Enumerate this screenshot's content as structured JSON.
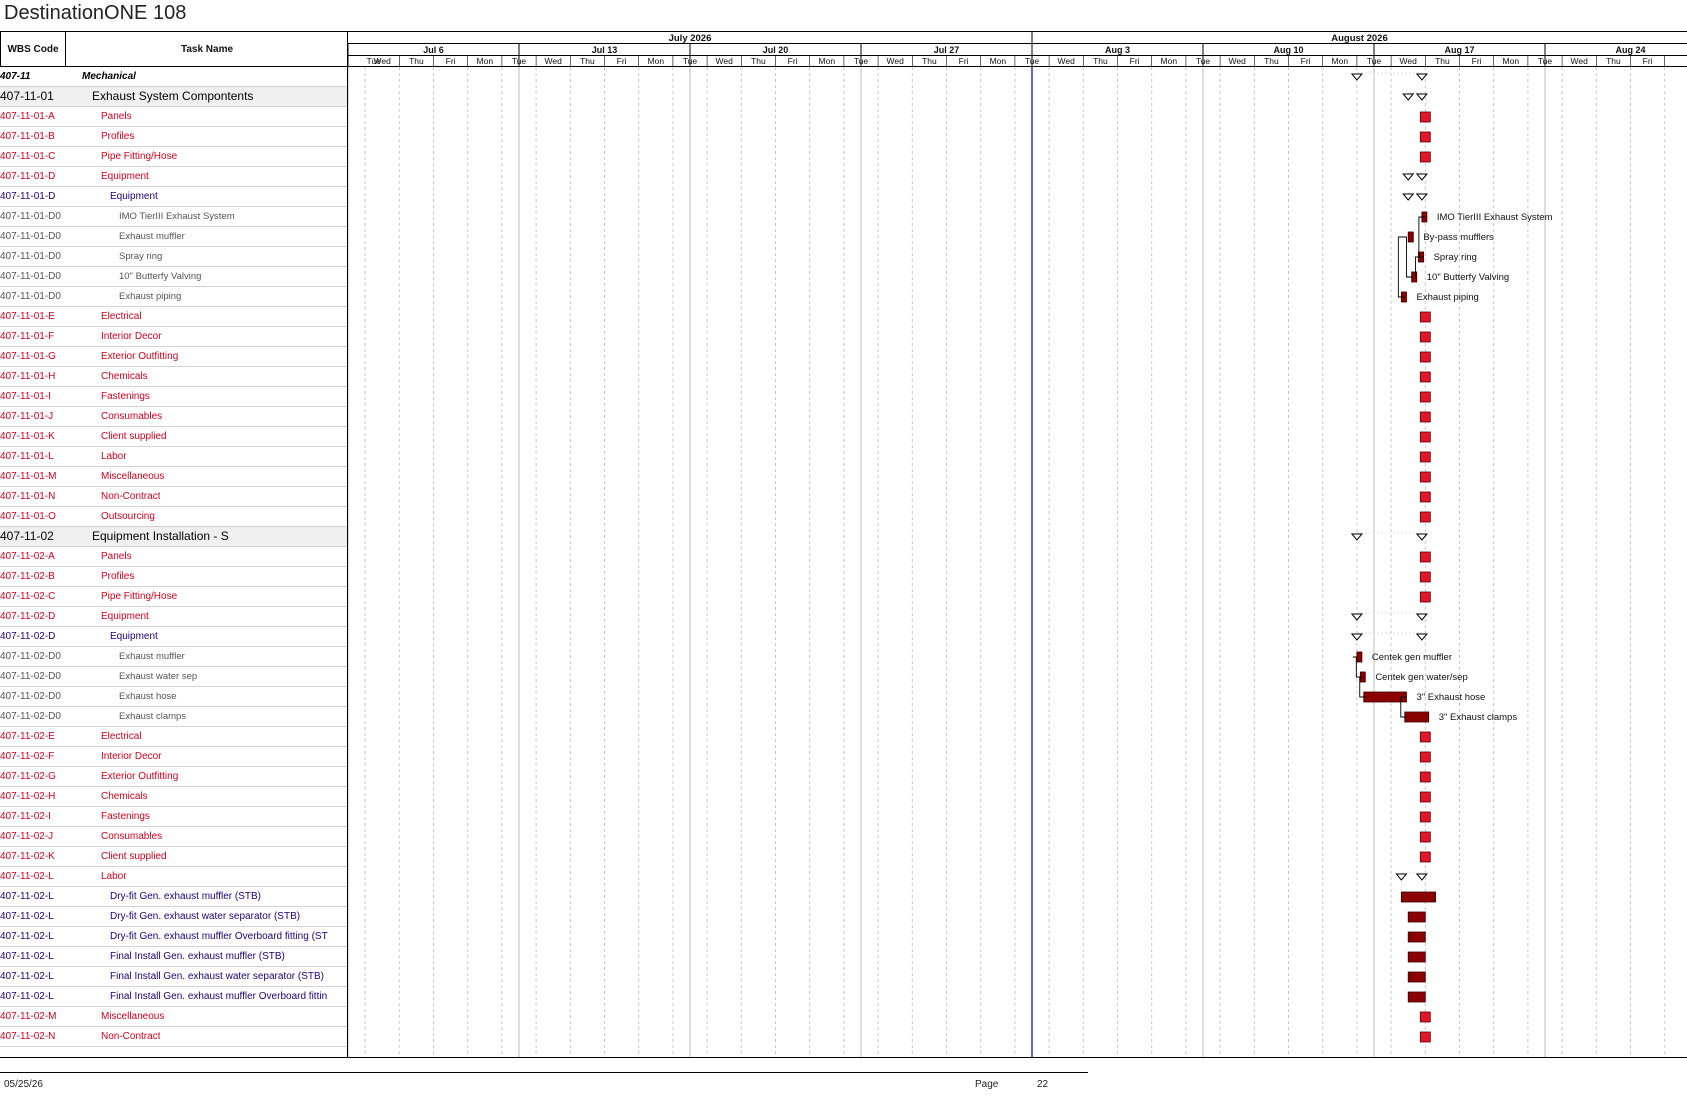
{
  "title": "DestinationONE 108",
  "columns": {
    "wbs": "WBS Code",
    "task": "Task Name"
  },
  "timescale": {
    "months": [
      {
        "label": "July 2026"
      },
      {
        "label": "August 2026"
      }
    ],
    "weeks": [
      "Jul 6",
      "Jul 13",
      "Jul 20",
      "Jul 27",
      "Aug 3",
      "Aug 10",
      "Aug 17",
      "Aug 24"
    ],
    "days": [
      "Tue",
      "Wed",
      "Thu",
      "Fri",
      "Mon",
      "Tue",
      "Wed",
      "Thu",
      "Fri",
      "Mon",
      "Tue",
      "Wed",
      "Thu",
      "Fri",
      "Mon",
      "Tue",
      "Wed",
      "Thu",
      "Fri",
      "Mon",
      "Tue",
      "Wed",
      "Thu",
      "Fri",
      "Mon",
      "Tue",
      "Wed",
      "Thu",
      "Fri",
      "Mon",
      "Tue",
      "Wed",
      "Thu",
      "Fri",
      "Mon",
      "Tue",
      "Wed",
      "Thu",
      "Fri"
    ]
  },
  "rows": [
    {
      "wbs": "407-11",
      "task": "Mechanical",
      "level": 0,
      "marker": "summary",
      "start": 29.0,
      "end": 30.9
    },
    {
      "wbs": "407-11-01",
      "task": "Exhaust System Compontents",
      "level": 1,
      "marker": "summary",
      "start": 30.5,
      "end": 30.9
    },
    {
      "wbs": "407-11-01-A",
      "task": "Panels",
      "level": 2,
      "marker": "milestone",
      "start": 31.0
    },
    {
      "wbs": "407-11-01-B",
      "task": "Profiles",
      "level": 2,
      "marker": "milestone",
      "start": 31.0
    },
    {
      "wbs": "407-11-01-C",
      "task": "Pipe Fitting/Hose",
      "level": 2,
      "marker": "milestone",
      "start": 31.0
    },
    {
      "wbs": "407-11-01-D",
      "task": "Equipment",
      "level": 2,
      "marker": "summary",
      "start": 30.5,
      "end": 30.9
    },
    {
      "wbs": "407-11-01-D",
      "task": "Equipment",
      "level": 3,
      "marker": "summary",
      "start": 30.5,
      "end": 30.9
    },
    {
      "wbs": "407-11-01-D0",
      "task": "IMO TierIII Exhaust System",
      "level": 4,
      "marker": "task",
      "start": 30.9,
      "end": 31.0,
      "bar_label": "IMO TierIII Exhaust System"
    },
    {
      "wbs": "407-11-01-D0",
      "task": "Exhaust muffler",
      "level": 4,
      "marker": "task",
      "start": 30.5,
      "end": 30.65,
      "bar_label": "By-pass mufflers"
    },
    {
      "wbs": "407-11-01-D0",
      "task": "Spray ring",
      "level": 4,
      "marker": "task",
      "start": 30.8,
      "end": 30.95,
      "bar_label": "Spray ring"
    },
    {
      "wbs": "407-11-01-D0",
      "task": "10\" Butterfy Valving",
      "level": 4,
      "marker": "task",
      "start": 30.6,
      "end": 30.75,
      "bar_label": "10\" Butterfy Valving"
    },
    {
      "wbs": "407-11-01-D0",
      "task": "Exhaust piping",
      "level": 4,
      "marker": "task",
      "start": 30.3,
      "end": 30.45,
      "bar_label": "Exhaust piping"
    },
    {
      "wbs": "407-11-01-E",
      "task": "Electrical",
      "level": 2,
      "marker": "milestone",
      "start": 31.0
    },
    {
      "wbs": "407-11-01-F",
      "task": "Interior Decor",
      "level": 2,
      "marker": "milestone",
      "start": 31.0
    },
    {
      "wbs": "407-11-01-G",
      "task": "Exterior Outfitting",
      "level": 2,
      "marker": "milestone",
      "start": 31.0
    },
    {
      "wbs": "407-11-01-H",
      "task": "Chemicals",
      "level": 2,
      "marker": "milestone",
      "start": 31.0
    },
    {
      "wbs": "407-11-01-I",
      "task": "Fastenings",
      "level": 2,
      "marker": "milestone",
      "start": 31.0
    },
    {
      "wbs": "407-11-01-J",
      "task": "Consumables",
      "level": 2,
      "marker": "milestone",
      "start": 31.0
    },
    {
      "wbs": "407-11-01-K",
      "task": "Client supplied",
      "level": 2,
      "marker": "milestone",
      "start": 31.0
    },
    {
      "wbs": "407-11-01-L",
      "task": "Labor",
      "level": 2,
      "marker": "milestone",
      "start": 31.0
    },
    {
      "wbs": "407-11-01-M",
      "task": "Miscellaneous",
      "level": 2,
      "marker": "milestone",
      "start": 31.0
    },
    {
      "wbs": "407-11-01-N",
      "task": "Non-Contract",
      "level": 2,
      "marker": "milestone",
      "start": 31.0
    },
    {
      "wbs": "407-11-01-O",
      "task": "Outsourcing",
      "level": 2,
      "marker": "milestone",
      "start": 31.0
    },
    {
      "wbs": "407-11-02",
      "task": "Equipment Installation - S",
      "level": 1,
      "marker": "summary",
      "start": 29.0,
      "end": 30.9
    },
    {
      "wbs": "407-11-02-A",
      "task": "Panels",
      "level": 2,
      "marker": "milestone",
      "start": 31.0
    },
    {
      "wbs": "407-11-02-B",
      "task": "Profiles",
      "level": 2,
      "marker": "milestone",
      "start": 31.0
    },
    {
      "wbs": "407-11-02-C",
      "task": "Pipe Fitting/Hose",
      "level": 2,
      "marker": "milestone",
      "start": 31.0
    },
    {
      "wbs": "407-11-02-D",
      "task": "Equipment",
      "level": 2,
      "marker": "summary",
      "start": 29.0,
      "end": 30.9
    },
    {
      "wbs": "407-11-02-D",
      "task": "Equipment",
      "level": 3,
      "marker": "summary",
      "start": 29.0,
      "end": 30.9
    },
    {
      "wbs": "407-11-02-D0",
      "task": "Exhaust muffler",
      "level": 4,
      "marker": "task",
      "start": 29.0,
      "end": 29.1,
      "bar_label": "Centek gen muffler"
    },
    {
      "wbs": "407-11-02-D0",
      "task": "Exhaust water sep",
      "level": 4,
      "marker": "task",
      "start": 29.1,
      "end": 29.2,
      "bar_label": "Centek gen water/sep"
    },
    {
      "wbs": "407-11-02-D0",
      "task": "Exhaust hose",
      "level": 4,
      "marker": "task",
      "start": 29.2,
      "end": 30.45,
      "bar_label": "3\" Exhaust hose"
    },
    {
      "wbs": "407-11-02-D0",
      "task": "Exhaust clamps",
      "level": 4,
      "marker": "task",
      "start": 30.4,
      "end": 31.1,
      "bar_label": "3\" Exhaust clamps"
    },
    {
      "wbs": "407-11-02-E",
      "task": "Electrical",
      "level": 2,
      "marker": "milestone",
      "start": 31.0
    },
    {
      "wbs": "407-11-02-F",
      "task": "Interior Decor",
      "level": 2,
      "marker": "milestone",
      "start": 31.0
    },
    {
      "wbs": "407-11-02-G",
      "task": "Exterior Outfitting",
      "level": 2,
      "marker": "milestone",
      "start": 31.0
    },
    {
      "wbs": "407-11-02-H",
      "task": "Chemicals",
      "level": 2,
      "marker": "milestone",
      "start": 31.0
    },
    {
      "wbs": "407-11-02-I",
      "task": "Fastenings",
      "level": 2,
      "marker": "milestone",
      "start": 31.0
    },
    {
      "wbs": "407-11-02-J",
      "task": "Consumables",
      "level": 2,
      "marker": "milestone",
      "start": 31.0
    },
    {
      "wbs": "407-11-02-K",
      "task": "Client supplied",
      "level": 2,
      "marker": "milestone",
      "start": 31.0
    },
    {
      "wbs": "407-11-02-L",
      "task": "Labor",
      "level": 2,
      "marker": "summary",
      "start": 30.3,
      "end": 30.9
    },
    {
      "wbs": "407-11-02-L",
      "task": "Dry-fit Gen. exhaust muffler (STB)",
      "level": 5,
      "marker": "task",
      "start": 30.3,
      "end": 31.3
    },
    {
      "wbs": "407-11-02-L",
      "task": "Dry-fit Gen. exhaust water separator (STB)",
      "level": 5,
      "marker": "task",
      "start": 30.5,
      "end": 31.0
    },
    {
      "wbs": "407-11-02-L",
      "task": "Dry-fit Gen. exhaust muffler Overboard fitting (ST",
      "level": 5,
      "marker": "task",
      "start": 30.5,
      "end": 31.0
    },
    {
      "wbs": "407-11-02-L",
      "task": "Final Install Gen. exhaust muffler (STB)",
      "level": 5,
      "marker": "task",
      "start": 30.5,
      "end": 31.0
    },
    {
      "wbs": "407-11-02-L",
      "task": "Final Install Gen. exhaust water separator (STB)",
      "level": 5,
      "marker": "task",
      "start": 30.5,
      "end": 31.0
    },
    {
      "wbs": "407-11-02-L",
      "task": "Final Install Gen. exhaust muffler Overboard fittin",
      "level": 5,
      "marker": "task",
      "start": 30.5,
      "end": 31.0
    },
    {
      "wbs": "407-11-02-M",
      "task": "Miscellaneous",
      "level": 2,
      "marker": "milestone",
      "start": 31.0
    },
    {
      "wbs": "407-11-02-N",
      "task": "Non-Contract",
      "level": 2,
      "marker": "milestone",
      "start": 31.0
    }
  ],
  "footer": {
    "date": "05/25/26",
    "page_label": "Page",
    "page_number": "22"
  },
  "colors": {
    "milestone": "#e0162a",
    "task_bar": "#8b0000",
    "current_date_line": "#2832c8",
    "grid_dash": "#c8c8c8"
  }
}
